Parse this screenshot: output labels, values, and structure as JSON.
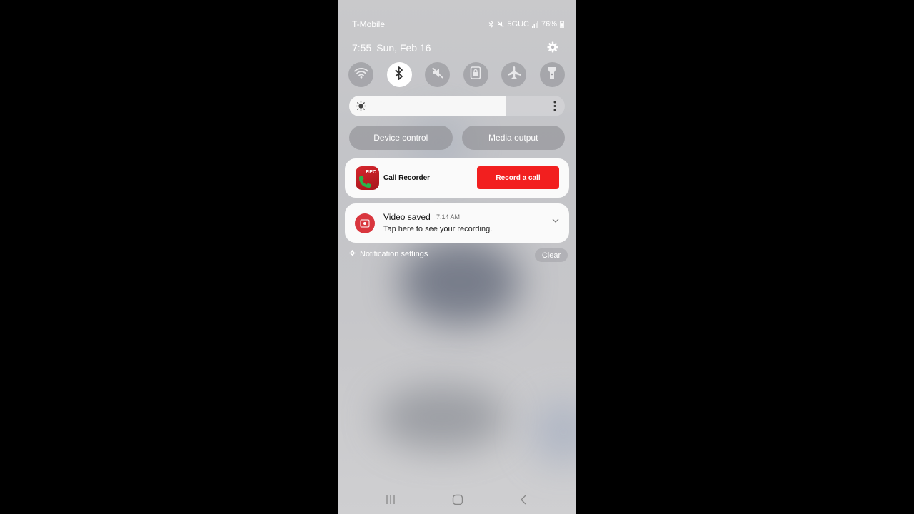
{
  "status_bar": {
    "carrier": "T-Mobile",
    "network": "5GUC",
    "battery": "76%",
    "icons": [
      "bluetooth-icon",
      "mute-icon",
      "signal-icon",
      "battery-icon"
    ]
  },
  "header": {
    "time": "7:55",
    "date": "Sun, Feb 16",
    "settings_icon": "gear-icon"
  },
  "quick_settings": [
    {
      "name": "wifi",
      "icon": "wifi-icon",
      "active": false
    },
    {
      "name": "bluetooth",
      "icon": "bluetooth-icon",
      "active": true
    },
    {
      "name": "sound",
      "icon": "mute-icon",
      "active": false
    },
    {
      "name": "rotation-lock",
      "icon": "lock-icon",
      "active": false
    },
    {
      "name": "airplane-mode",
      "icon": "airplane-icon",
      "active": false
    },
    {
      "name": "flashlight",
      "icon": "flashlight-icon",
      "active": false
    }
  ],
  "brightness": {
    "level": 0.73
  },
  "buttons": {
    "device_control": "Device control",
    "media_output": "Media output"
  },
  "call_recorder": {
    "badge": "REC",
    "app_name": "Call Recorder",
    "action": "Record a call"
  },
  "video_notification": {
    "title": "Video saved",
    "time": "7:14 AM",
    "body": "Tap here to see your recording."
  },
  "footer": {
    "settings_link": "Notification settings",
    "clear": "Clear"
  },
  "colors": {
    "accent_red": "#f21f1f",
    "record_icon": "#d9363e"
  }
}
